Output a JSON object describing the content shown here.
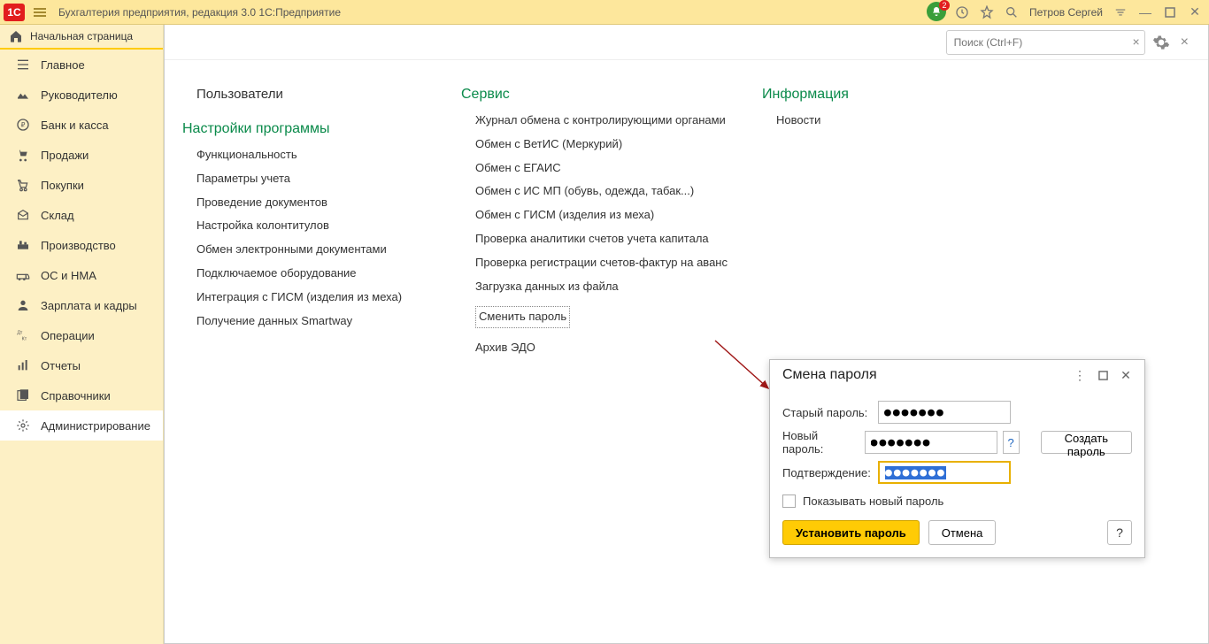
{
  "titlebar": {
    "logo": "1C",
    "title": "Бухгалтерия предприятия, редакция 3.0 1С:Предприятие",
    "notif_count": "2",
    "user": "Петров Сергей"
  },
  "nav": {
    "start": "Начальная страница",
    "items": [
      "Главное",
      "Руководителю",
      "Банк и касса",
      "Продажи",
      "Покупки",
      "Склад",
      "Производство",
      "ОС и НМА",
      "Зарплата и кадры",
      "Операции",
      "Отчеты",
      "Справочники",
      "Администрирование"
    ],
    "selected_index": 12
  },
  "search": {
    "placeholder": "Поиск (Ctrl+F)"
  },
  "columns": {
    "c1_top": "Пользователи",
    "c1_head": "Настройки программы",
    "c1": [
      "Функциональность",
      "Параметры учета",
      "Проведение документов",
      "Настройка колонтитулов",
      "Обмен электронными документами",
      "Подключаемое оборудование",
      "Интеграция с ГИСМ (изделия из меха)",
      "Получение данных Smartway"
    ],
    "c2_head": "Сервис",
    "c2": [
      "Журнал обмена с контролирующими органами",
      "Обмен с ВетИС (Меркурий)",
      "Обмен с ЕГАИС",
      "Обмен с ИС МП (обувь, одежда, табак...)",
      "Обмен с ГИСМ (изделия из меха)",
      "Проверка аналитики счетов учета капитала",
      "Проверка регистрации счетов-фактур на аванс",
      "Загрузка данных из файла",
      "Сменить пароль",
      "Архив ЭДО"
    ],
    "c2_dotted_index": 8,
    "c3_head": "Информация",
    "c3": [
      "Новости"
    ]
  },
  "dialog": {
    "title": "Смена пароля",
    "old_label": "Старый пароль:",
    "new_label": "Новый пароль:",
    "conf_label": "Подтверждение:",
    "old_value": "●●●●●●●",
    "new_value": "●●●●●●●",
    "conf_value": "●●●●●●●",
    "gen": "Создать пароль",
    "show": "Показывать новый пароль",
    "set": "Установить пароль",
    "cancel": "Отмена",
    "q": "?"
  }
}
